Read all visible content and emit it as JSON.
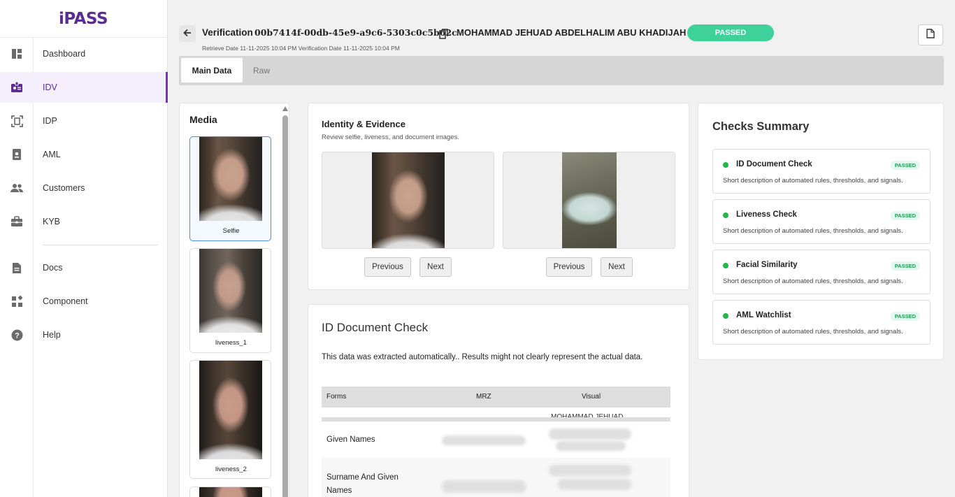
{
  "app": {
    "logo": "iPASS"
  },
  "sidebar": {
    "items": [
      {
        "label": "Dashboard",
        "icon": "dashboard-icon"
      },
      {
        "label": "IDV",
        "icon": "id-badge-icon",
        "active": true
      },
      {
        "label": "IDP",
        "icon": "scan-document-icon"
      },
      {
        "label": "AML",
        "icon": "contact-card-icon"
      },
      {
        "label": "Customers",
        "icon": "people-icon"
      },
      {
        "label": "KYB",
        "icon": "briefcase-icon"
      },
      {
        "label": "Docs",
        "icon": "document-icon"
      },
      {
        "label": "Component",
        "icon": "widgets-icon"
      },
      {
        "label": "Help",
        "icon": "help-icon"
      }
    ]
  },
  "header": {
    "title": "Verification",
    "verification_id": "00b7414f-00db-45e9-a9c6-5303c0c5b62c",
    "customer_name": "MOHAMMAD JEHUAD ABDELHALIM ABU KHADIJAH",
    "status": "PASSED",
    "dates": "Retrieve Date 11-11-2025 10:04 PM Verification Date 11-11-2025 10:04 PM"
  },
  "tabs": [
    {
      "label": "Main Data",
      "active": true
    },
    {
      "label": "Raw",
      "active": false
    }
  ],
  "media": {
    "title": "Media",
    "items": [
      {
        "caption": "Selfie",
        "selected": true
      },
      {
        "caption": "liveness_1",
        "selected": false
      },
      {
        "caption": "liveness_2",
        "selected": false
      }
    ]
  },
  "identity": {
    "title": "Identity & Evidence",
    "subtitle": "Review selfie, liveness, and document images.",
    "previous_label": "Previous",
    "next_label": "Next"
  },
  "id_document": {
    "title": "ID Document Check",
    "note": "This data was extracted automatically.. Results might not clearly represent the actual data.",
    "columns": [
      "Forms",
      "MRZ",
      "Visual"
    ],
    "partial_visual": "MOHAMMAD JEHUAD",
    "rows": [
      {
        "label": "Given Names"
      },
      {
        "label": "Surname And Given Names"
      }
    ]
  },
  "checks": {
    "title": "Checks Summary",
    "badge": "PASSED",
    "description": "Short description of automated rules, thresholds, and signals.",
    "items": [
      {
        "name": "ID Document Check"
      },
      {
        "name": "Liveness Check"
      },
      {
        "name": "Facial Similarity"
      },
      {
        "name": "AML Watchlist"
      }
    ]
  },
  "colors": {
    "brand": "#5b2c91",
    "accent": "#7b2fbe",
    "passed": "#3ed19a",
    "check_dot": "#22b74a"
  }
}
